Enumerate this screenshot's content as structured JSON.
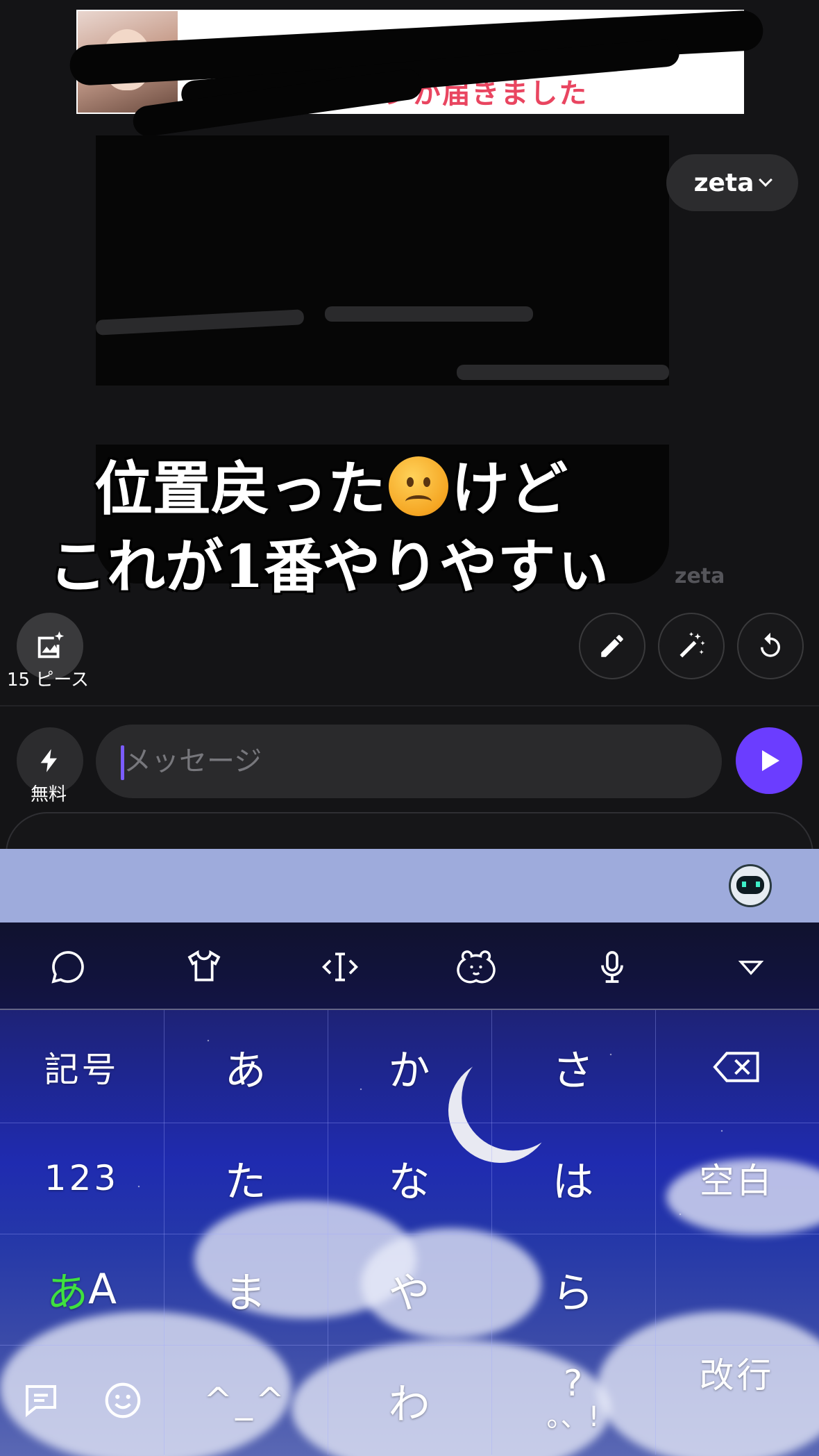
{
  "chat": {
    "notification_text": "ナさん…ッセージが届きました",
    "model_selector": "zeta",
    "caption_line1_a": "位置戻った",
    "caption_line1_b": "けど",
    "caption_line2": "これが1番やりやすぃ",
    "watermark": "zeta"
  },
  "actions": {
    "pieces_label": "15 ピース"
  },
  "input": {
    "free_label": "無料",
    "placeholder": "メッセージ",
    "asterisk": "*"
  },
  "keyboard": {
    "rows": [
      [
        "記号",
        "あ",
        "か",
        "さ",
        ""
      ],
      [
        "123",
        "た",
        "な",
        "は",
        "空白"
      ],
      [
        "あA",
        "ま",
        "や",
        "ら",
        ""
      ],
      [
        "",
        "^_^",
        "わ",
        "?。、!",
        "改行"
      ]
    ],
    "key_kigo": "記号",
    "key_a": "あ",
    "key_ka": "か",
    "key_sa": "さ",
    "key_123": "123",
    "key_ta": "た",
    "key_na": "な",
    "key_ha": "は",
    "key_space": "空白",
    "key_mode_green": "あ",
    "key_mode_a": "A",
    "key_ma": "ま",
    "key_ya": "や",
    "key_ra": "ら",
    "key_kaomoji": "^_^",
    "key_wa": "わ",
    "key_punct_top": "?",
    "key_punct_bottom": "。、!",
    "key_enter": "改行"
  },
  "colors": {
    "send_button": "#6b3dff",
    "caret": "#7b5cff",
    "keyboard_bar": "#9eabdc",
    "mode_green": "#3fe13f"
  }
}
